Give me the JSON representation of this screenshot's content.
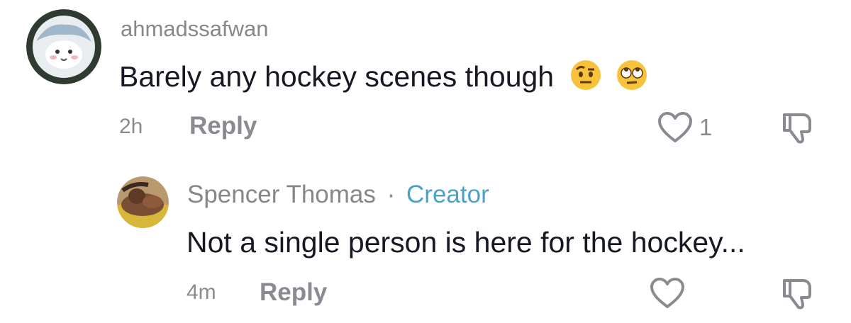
{
  "comments": [
    {
      "username": "ahmadssafwan",
      "text": "Barely any hockey scenes though",
      "emojis": [
        "raised-eyebrow-emoji",
        "eye-roll-emoji"
      ],
      "time": "2h",
      "reply_label": "Reply",
      "like_count": "1",
      "avatar": "cartoon-avatar"
    }
  ],
  "replies": [
    {
      "username": "Spencer Thomas",
      "separator": "·",
      "badge": "Creator",
      "text": "Not a single person is here for the hockey...",
      "time": "4m",
      "reply_label": "Reply",
      "like_count": "",
      "avatar": "photo-avatar"
    }
  ],
  "colors": {
    "creator_badge": "#4ba2c9",
    "username": "#86868b",
    "body_text": "#161823",
    "meta": "#8a8b91"
  }
}
